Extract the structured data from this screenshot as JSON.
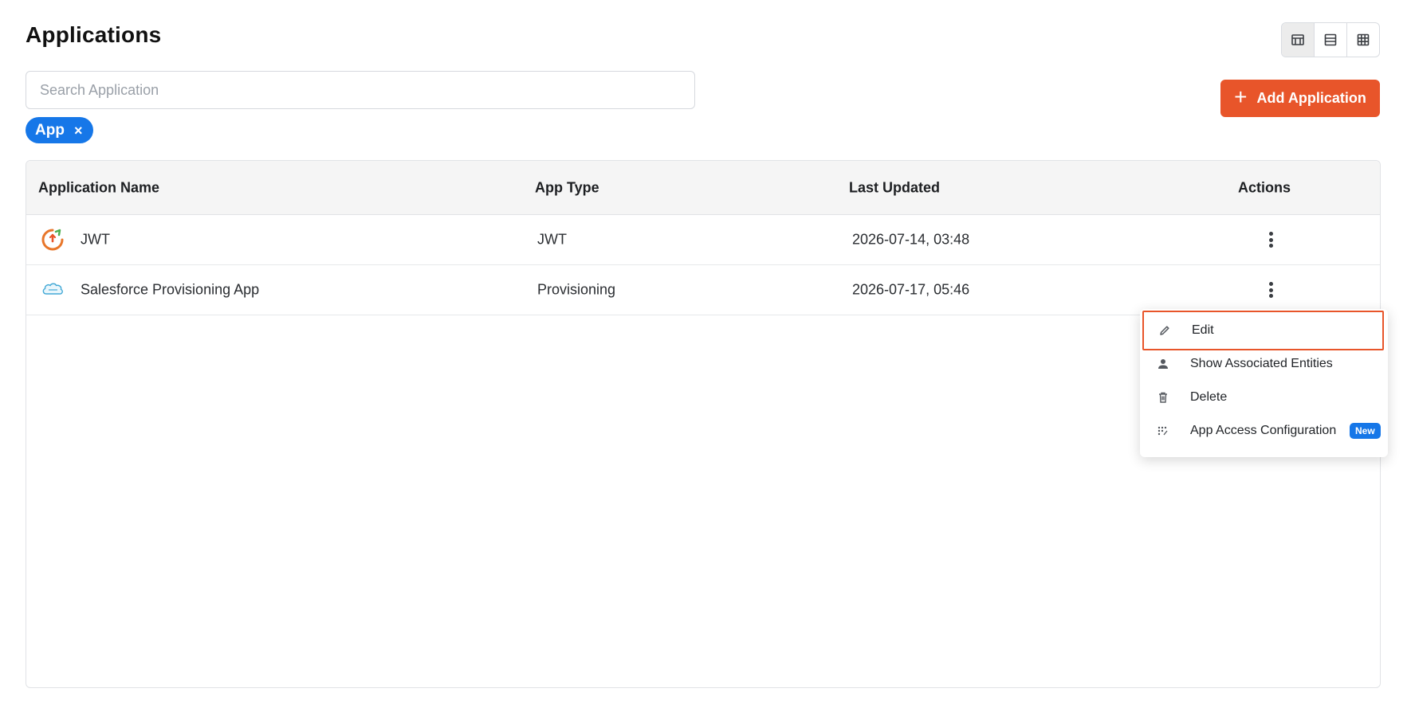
{
  "page": {
    "title": "Applications"
  },
  "view_toggle": [
    {
      "name": "card-view",
      "icon": "table-layout-icon",
      "active": true
    },
    {
      "name": "list-view",
      "icon": "list-rows-icon",
      "active": false
    },
    {
      "name": "grid-view",
      "icon": "grid-icon",
      "active": false
    }
  ],
  "search": {
    "placeholder": "Search Application",
    "value": ""
  },
  "filter_chip": {
    "label": "App",
    "remove": "×"
  },
  "add_button": {
    "label": "Add Application",
    "icon": "+"
  },
  "table": {
    "headers": {
      "name": "Application Name",
      "type": "App Type",
      "updated": "Last Updated",
      "actions": "Actions"
    },
    "rows": [
      {
        "icon": "jwt-app-icon",
        "name": "JWT",
        "type": "JWT",
        "updated": "2026-07-14, 03:48"
      },
      {
        "icon": "salesforce-cloud-icon",
        "name": "Salesforce Provisioning App",
        "type": "Provisioning",
        "updated": "2026-07-17, 05:46"
      }
    ]
  },
  "actions_menu": {
    "items": [
      {
        "label": "Edit",
        "icon": "pencil-icon",
        "highlighted": true
      },
      {
        "label": "Show Associated Entities",
        "icon": "user-icon"
      },
      {
        "label": "Delete",
        "icon": "trash-icon"
      },
      {
        "label": "App Access Configuration",
        "icon": "dots-grid-icon",
        "badge": "New"
      }
    ]
  },
  "colors": {
    "accent_orange": "#e8552a",
    "chip_blue": "#1677e8"
  }
}
